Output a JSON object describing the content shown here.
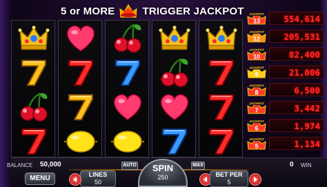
{
  "banner": {
    "left_text": "5 or MORE",
    "right_text": "TRIGGER JACKPOT"
  },
  "reels": [
    [
      "crown",
      "seven-yellow",
      "cherries",
      "seven-red"
    ],
    [
      "heart",
      "seven-red",
      "seven-yellow",
      "lemon"
    ],
    [
      "cherries",
      "seven-blue",
      "heart",
      "lemon"
    ],
    [
      "crown",
      "cherries",
      "heart",
      "seven-blue"
    ],
    [
      "crown",
      "seven-red",
      "seven-red",
      "seven-red"
    ]
  ],
  "jackpots": [
    {
      "level": "13",
      "value": "554,614",
      "color": "#ff3a2a"
    },
    {
      "level": "12",
      "value": "205,531",
      "color": "#ff8a1a"
    },
    {
      "level": "10",
      "value": "82,400",
      "color": "#ff3a2a"
    },
    {
      "level": "9",
      "value": "21,006",
      "color": "#ffcc22"
    },
    {
      "level": "8",
      "value": "6,500",
      "color": "#ff3a2a"
    },
    {
      "level": "7",
      "value": "3,442",
      "color": "#ff3a2a"
    },
    {
      "level": "6",
      "value": "1,974",
      "color": "#ff3a2a"
    },
    {
      "level": "5",
      "value": "1,134",
      "color": "#ff3a2a"
    }
  ],
  "jackpot_badge_text": "JACKPOT",
  "controls": {
    "balance_label": "BALANCE",
    "balance_value": "50,000",
    "win_value": "0",
    "win_label": "WIN",
    "menu_label": "MENU",
    "auto_label": "AUTO",
    "max_label": "MAX",
    "lines_label": "LINES",
    "lines_value": "50",
    "spin_label": "SPIN",
    "spin_bet": "250",
    "bet_per_label": "BET PER",
    "bet_per_value": "5"
  },
  "colors": {
    "accent": "#ff2b2b",
    "brand_purple": "#3b1a66"
  }
}
